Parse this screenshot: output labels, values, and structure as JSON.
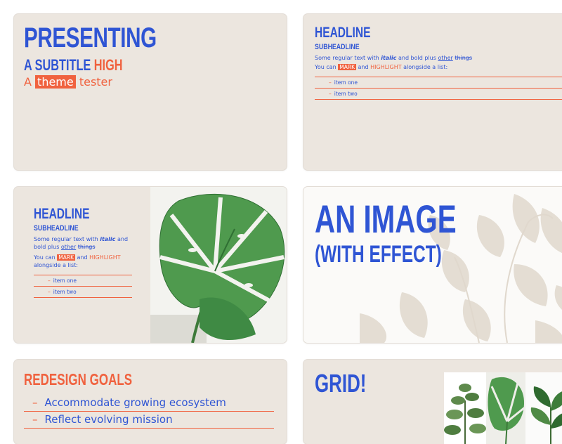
{
  "colors": {
    "blue": "#2f55d4",
    "red": "#f0623f",
    "slide_bg": "#ece6df"
  },
  "slide1": {
    "title": "PRESENTING",
    "subtitle_prefix": "A SUBTITLE ",
    "subtitle_highlight": "HIGH",
    "tagline_a": "A",
    "tagline_mark": "theme",
    "tagline_b": "tester"
  },
  "slide2": {
    "headline": "HEADLINE",
    "subheadline": "SUBHEADLINE",
    "text1_a": "Some regular text with ",
    "text1_italic": "italic",
    "text1_b": " and bold plus ",
    "text1_underline": "other",
    "text1_strike": "things",
    "text2_a": "You can ",
    "text2_mark": "MARK",
    "text2_b": " and ",
    "text2_highlight": "HIGHLIGHT",
    "text2_c": " alongside a list:",
    "list": [
      "item one",
      "item two"
    ]
  },
  "slide3": {
    "headline": "HEADLINE",
    "subheadline": "SUBHEADLINE",
    "text1_a": "Some regular text with ",
    "text1_italic": "italic",
    "text1_b": " and bold plus ",
    "text1_underline": "other",
    "text1_strike": "things",
    "text2_a": "You can ",
    "text2_mark": "MARK",
    "text2_b": " and ",
    "text2_highlight": "HIGHLIGHT",
    "text2_c": " alongside a list:",
    "list": [
      "item one",
      "item two"
    ],
    "image_icon": "monstera-leaf-icon"
  },
  "slide4": {
    "line1": "AN IMAGE",
    "line2": "(WITH EFFECT)",
    "image_icon": "plant-silhouette-icon"
  },
  "slide5": {
    "title": "REDESIGN GOALS",
    "goals": [
      "Accommodate growing ecosystem",
      "Reflect evolving mission"
    ]
  },
  "slide6": {
    "title": "GRID!",
    "images": [
      "plant-icon",
      "monstera-leaf-icon",
      "plant-icon"
    ]
  }
}
